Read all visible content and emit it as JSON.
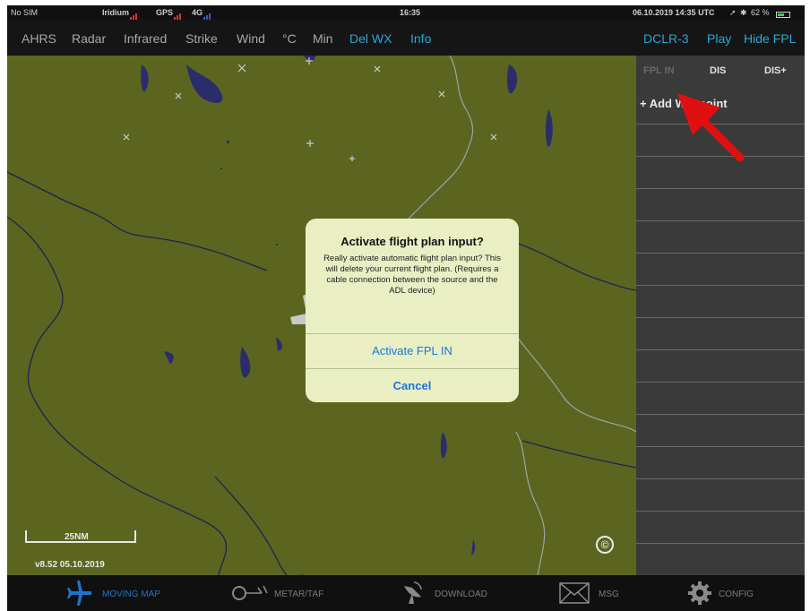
{
  "status_bar": {
    "carrier": "No SIM",
    "iridium_label": "Iridium",
    "gps_label": "GPS",
    "cell_label": "4G",
    "center_time": "16:35",
    "date_utc": "06.10.2019 14:35 UTC",
    "battery_percent": "62 %",
    "battery_level": 0.62
  },
  "top_menu": {
    "left_items": [
      "AHRS",
      "Radar",
      "Infrared",
      "Strike",
      "Wind",
      "°C",
      "Min",
      "Del WX",
      "Info"
    ],
    "right_items": [
      "DCLR-3",
      "Play",
      "Hide FPL"
    ],
    "accent_color": "#27a7d8"
  },
  "map": {
    "scale_label": "25NM",
    "version": "v8.52 05.10.2019",
    "copyright_symbol": "©",
    "land_color": "#5b6520",
    "water_color": "#2a2d6a"
  },
  "fpl_panel": {
    "tabs": [
      "FPL IN",
      "DIS",
      "DIS+"
    ],
    "add_waypoint": "+ Add Waypoint"
  },
  "dialog": {
    "title": "Activate flight plan input?",
    "message": "Really activate automatic flight plan input? This will delete your current flight plan. (Requires a cable connection between the source and the ADL device)",
    "confirm_button": "Activate FPL IN",
    "cancel_button": "Cancel",
    "button_color": "#1a76d8"
  },
  "tab_bar": {
    "items": [
      {
        "label": "MOVING MAP",
        "icon": "airplane-icon",
        "active": true
      },
      {
        "label": "METAR/TAF",
        "icon": "windsock-icon",
        "active": false
      },
      {
        "label": "DOWNLOAD",
        "icon": "satellite-dish-icon",
        "active": false
      },
      {
        "label": "MSG",
        "icon": "envelope-icon",
        "active": false
      },
      {
        "label": "CONFIG",
        "icon": "gear-icon",
        "active": false
      }
    ],
    "active_color": "#1e74c8"
  }
}
